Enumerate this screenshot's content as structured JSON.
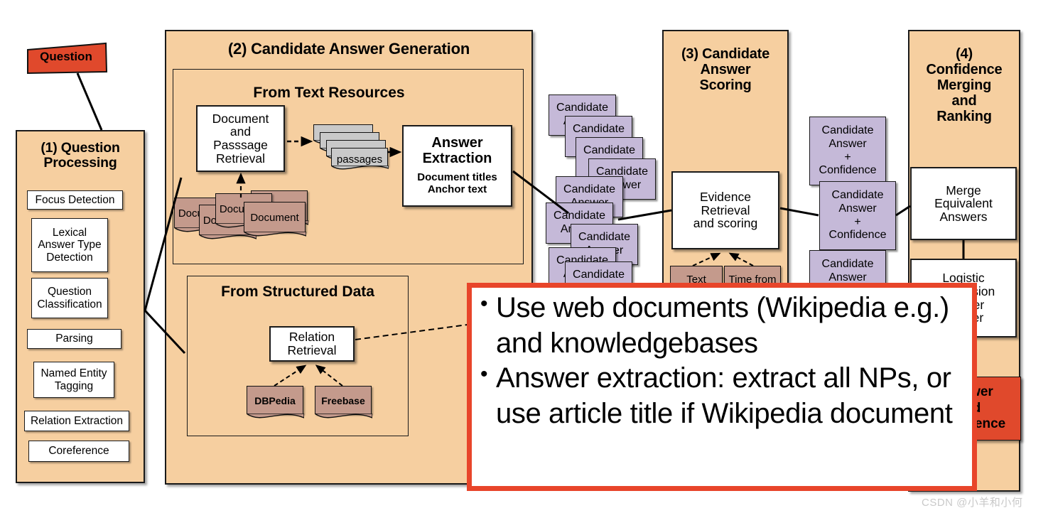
{
  "question_node": {
    "label": "Question"
  },
  "panel1": {
    "title": "(1) Question\nProcessing",
    "title_line1": "(1) Question",
    "title_line2": "Processing",
    "items": [
      {
        "label": "Focus Detection"
      },
      {
        "label": "Lexical\nAnswer Type\nDetection"
      },
      {
        "label": "Question\nClassification"
      },
      {
        "label": "Parsing"
      },
      {
        "label": "Named Entity\nTagging"
      },
      {
        "label": "Relation Extraction"
      },
      {
        "label": "Coreference"
      }
    ]
  },
  "panel2": {
    "title": "(2) Candidate Answer Generation",
    "section_text": {
      "title": "From Text Resources"
    },
    "section_structured": {
      "title": "From Structured Data"
    },
    "doc_passage_retrieval": "Document\nand\nPasssage\nRetrieval",
    "passages_label": "passages",
    "answer_extraction": {
      "title": "Answer\nExtraction",
      "line1": "Answer",
      "line2": "Extraction",
      "sub1": "Document titles",
      "sub2": "Anchor text"
    },
    "documents": [
      "Document",
      "Document",
      "Document",
      "Document",
      "Document"
    ],
    "relation_retrieval": "Relation\nRetrieval",
    "kbs": [
      "DBPedia",
      "Freebase"
    ]
  },
  "panel3": {
    "title": "(3) Candidate\nAnswer\nScoring",
    "title_line1": "(3) Candidate",
    "title_line2": "Answer",
    "title_line3": "Scoring",
    "evidence_box": "Evidence\nRetrieval\nand scoring",
    "evidence_sources": [
      "Text",
      "Time from"
    ]
  },
  "panel4": {
    "title": "(4)\nConfidence\nMerging\nand\nRanking",
    "title_line1": "(4)",
    "title_line2": "Confidence",
    "title_line3": "Merging",
    "title_line4": "and",
    "title_line5": "Ranking",
    "merge_box": "Merge\nEquivalent\nAnswers",
    "logistic_box": "Logistic\nRegression\nAnswer\nRanker"
  },
  "candidate_stack_left": {
    "label": "Candidate\nAnswer",
    "count": 8
  },
  "candidate_stack_right": {
    "label": "Candidate\nAnswer\n+\nConfidence",
    "count": 3
  },
  "answer_node": {
    "label": "Answer\nand\nConfidence"
  },
  "callout": {
    "bullets": [
      "Use web documents (Wikipedia e.g.) and knowledgebases",
      "Answer extraction: extract all NPs, or use article title if Wikipedia document"
    ]
  },
  "watermark": {
    "text": "CSDN @小羊和小何"
  },
  "colors": {
    "panel_fill": "#f6cfa0",
    "document_fill": "#c49a8c",
    "passage_fill": "#c9c9c9",
    "candidate_fill": "#c5b9d8",
    "red_accent": "#e0492c",
    "callout_border": "#e8452a",
    "stroke": "#1a1a1a"
  }
}
